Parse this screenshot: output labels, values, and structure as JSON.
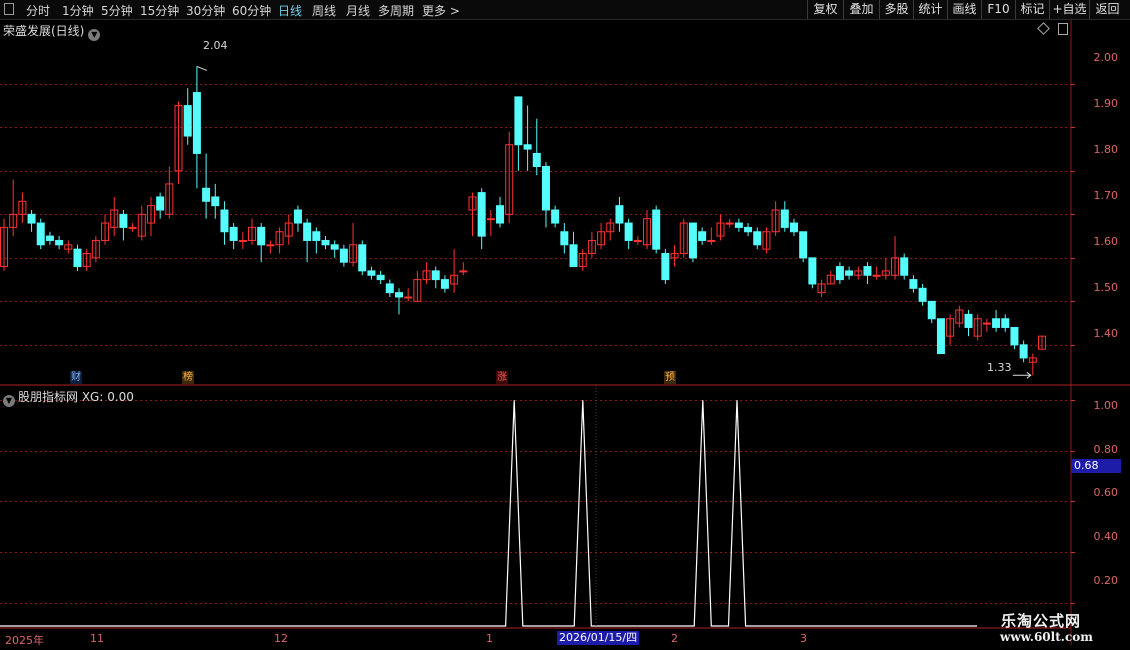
{
  "toolbar": {
    "periods": [
      "分时",
      "1分钟",
      "5分钟",
      "15分钟",
      "30分钟",
      "60分钟",
      "日线",
      "周线",
      "月线",
      "多周期",
      "更多 >"
    ],
    "active_period": "日线",
    "right_buttons": [
      "复权",
      "叠加",
      "多股",
      "统计",
      "画线",
      "F10",
      "标记",
      "+自选",
      "返回"
    ]
  },
  "main_panel": {
    "title": "荣盛发展(日线)",
    "high_label": "2.04",
    "low_label": "1.33",
    "y_ticks": [
      "2.00",
      "1.90",
      "1.80",
      "1.70",
      "1.60",
      "1.50",
      "1.40"
    ],
    "event_markers": [
      "财",
      "榜",
      "涨",
      "预"
    ]
  },
  "indicator_panel": {
    "title": "股朋指标网 XG: 0.00",
    "y_ticks": [
      "1.00",
      "0.80",
      "0.60",
      "0.40",
      "0.20"
    ],
    "current_value": "0.68"
  },
  "date_axis": {
    "labels": [
      "2025年",
      "11",
      "12",
      "1",
      "2",
      "3"
    ],
    "cursor_date": "2026/01/15/四"
  },
  "watermark": {
    "line1": "乐淘公式网",
    "line2": "www.60lt.com"
  },
  "colors": {
    "up": "#ff3232",
    "down": "#54fcfc",
    "background": "#000000",
    "grid": "#8a1a1a",
    "indicator_line": "#ffffff"
  },
  "chart_data": [
    {
      "type": "candlestick",
      "title": "荣盛发展(日线)",
      "ylim": [
        1.31,
        2.11
      ],
      "candles": [
        [
          1.58,
          1.67,
          1.57,
          1.69
        ],
        [
          1.67,
          1.7,
          1.65,
          1.78
        ],
        [
          1.7,
          1.73,
          1.68,
          1.75
        ],
        [
          1.7,
          1.68,
          1.66,
          1.71
        ],
        [
          1.68,
          1.63,
          1.62,
          1.69
        ],
        [
          1.65,
          1.64,
          1.63,
          1.66
        ],
        [
          1.64,
          1.63,
          1.62,
          1.65
        ],
        [
          1.62,
          1.63,
          1.61,
          1.64
        ],
        [
          1.62,
          1.58,
          1.57,
          1.63
        ],
        [
          1.58,
          1.61,
          1.57,
          1.62
        ],
        [
          1.6,
          1.64,
          1.59,
          1.65
        ],
        [
          1.64,
          1.68,
          1.63,
          1.7
        ],
        [
          1.67,
          1.71,
          1.65,
          1.74
        ],
        [
          1.7,
          1.67,
          1.64,
          1.71
        ],
        [
          1.67,
          1.67,
          1.66,
          1.68
        ],
        [
          1.65,
          1.7,
          1.64,
          1.72
        ],
        [
          1.68,
          1.72,
          1.65,
          1.74
        ],
        [
          1.74,
          1.71,
          1.69,
          1.75
        ],
        [
          1.7,
          1.77,
          1.69,
          1.81
        ],
        [
          1.8,
          1.95,
          1.77,
          1.96
        ],
        [
          1.95,
          1.88,
          1.86,
          1.99
        ],
        [
          1.98,
          1.84,
          1.76,
          2.04
        ],
        [
          1.76,
          1.73,
          1.69,
          1.84
        ],
        [
          1.74,
          1.72,
          1.69,
          1.77
        ],
        [
          1.71,
          1.66,
          1.63,
          1.73
        ],
        [
          1.67,
          1.64,
          1.62,
          1.68
        ],
        [
          1.64,
          1.64,
          1.62,
          1.66
        ],
        [
          1.64,
          1.67,
          1.63,
          1.69
        ],
        [
          1.67,
          1.63,
          1.59,
          1.68
        ],
        [
          1.63,
          1.63,
          1.61,
          1.64
        ],
        [
          1.63,
          1.66,
          1.61,
          1.67
        ],
        [
          1.65,
          1.68,
          1.63,
          1.7
        ],
        [
          1.71,
          1.68,
          1.66,
          1.72
        ],
        [
          1.68,
          1.64,
          1.59,
          1.69
        ],
        [
          1.66,
          1.64,
          1.61,
          1.67
        ],
        [
          1.64,
          1.63,
          1.62,
          1.65
        ],
        [
          1.63,
          1.62,
          1.6,
          1.64
        ],
        [
          1.62,
          1.59,
          1.58,
          1.63
        ],
        [
          1.59,
          1.63,
          1.58,
          1.68
        ],
        [
          1.63,
          1.57,
          1.56,
          1.64
        ],
        [
          1.57,
          1.56,
          1.55,
          1.58
        ],
        [
          1.56,
          1.55,
          1.54,
          1.57
        ],
        [
          1.54,
          1.52,
          1.51,
          1.55
        ],
        [
          1.52,
          1.51,
          1.47,
          1.53
        ],
        [
          1.51,
          1.51,
          1.5,
          1.53
        ],
        [
          1.5,
          1.55,
          1.5,
          1.57
        ],
        [
          1.55,
          1.57,
          1.54,
          1.59
        ],
        [
          1.57,
          1.55,
          1.53,
          1.58
        ],
        [
          1.55,
          1.53,
          1.52,
          1.56
        ],
        [
          1.54,
          1.56,
          1.52,
          1.62
        ],
        [
          1.57,
          1.57,
          1.56,
          1.59
        ],
        [
          1.71,
          1.74,
          1.65,
          1.75
        ],
        [
          1.75,
          1.65,
          1.62,
          1.76
        ],
        [
          1.69,
          1.69,
          1.65,
          1.71
        ],
        [
          1.72,
          1.68,
          1.67,
          1.74
        ],
        [
          1.7,
          1.86,
          1.68,
          1.89
        ],
        [
          1.97,
          1.86,
          1.8,
          1.97
        ],
        [
          1.86,
          1.85,
          1.8,
          1.95
        ],
        [
          1.84,
          1.81,
          1.79,
          1.92
        ],
        [
          1.81,
          1.71,
          1.67,
          1.82
        ],
        [
          1.71,
          1.68,
          1.67,
          1.72
        ],
        [
          1.66,
          1.63,
          1.61,
          1.68
        ],
        [
          1.63,
          1.58,
          1.58,
          1.66
        ],
        [
          1.58,
          1.61,
          1.57,
          1.62
        ],
        [
          1.61,
          1.64,
          1.6,
          1.66
        ],
        [
          1.63,
          1.66,
          1.62,
          1.68
        ],
        [
          1.66,
          1.68,
          1.64,
          1.69
        ],
        [
          1.72,
          1.68,
          1.66,
          1.74
        ],
        [
          1.68,
          1.64,
          1.62,
          1.69
        ],
        [
          1.64,
          1.64,
          1.63,
          1.65
        ],
        [
          1.63,
          1.69,
          1.62,
          1.71
        ],
        [
          1.71,
          1.62,
          1.61,
          1.72
        ],
        [
          1.61,
          1.55,
          1.54,
          1.62
        ],
        [
          1.6,
          1.61,
          1.58,
          1.63
        ],
        [
          1.61,
          1.68,
          1.6,
          1.69
        ],
        [
          1.68,
          1.6,
          1.59,
          1.68
        ],
        [
          1.66,
          1.64,
          1.63,
          1.67
        ],
        [
          1.64,
          1.64,
          1.63,
          1.67
        ],
        [
          1.65,
          1.68,
          1.64,
          1.7
        ],
        [
          1.68,
          1.68,
          1.67,
          1.69
        ],
        [
          1.68,
          1.67,
          1.66,
          1.69
        ],
        [
          1.67,
          1.66,
          1.65,
          1.68
        ],
        [
          1.66,
          1.63,
          1.62,
          1.67
        ],
        [
          1.62,
          1.66,
          1.61,
          1.67
        ],
        [
          1.66,
          1.71,
          1.65,
          1.73
        ],
        [
          1.71,
          1.67,
          1.66,
          1.73
        ],
        [
          1.68,
          1.66,
          1.65,
          1.69
        ],
        [
          1.66,
          1.6,
          1.59,
          1.66
        ],
        [
          1.6,
          1.54,
          1.53,
          1.6
        ],
        [
          1.52,
          1.54,
          1.51,
          1.55
        ],
        [
          1.54,
          1.56,
          1.54,
          1.57
        ],
        [
          1.58,
          1.55,
          1.54,
          1.59
        ],
        [
          1.57,
          1.56,
          1.55,
          1.58
        ],
        [
          1.56,
          1.57,
          1.55,
          1.58
        ],
        [
          1.58,
          1.56,
          1.54,
          1.59
        ],
        [
          1.56,
          1.56,
          1.55,
          1.58
        ],
        [
          1.56,
          1.57,
          1.55,
          1.6
        ],
        [
          1.56,
          1.6,
          1.55,
          1.65
        ],
        [
          1.6,
          1.56,
          1.55,
          1.61
        ],
        [
          1.55,
          1.53,
          1.52,
          1.56
        ],
        [
          1.53,
          1.5,
          1.49,
          1.54
        ],
        [
          1.5,
          1.46,
          1.45,
          1.5
        ],
        [
          1.46,
          1.38,
          1.38,
          1.46
        ],
        [
          1.42,
          1.46,
          1.4,
          1.47
        ],
        [
          1.45,
          1.48,
          1.44,
          1.49
        ],
        [
          1.47,
          1.44,
          1.42,
          1.48
        ],
        [
          1.42,
          1.46,
          1.41,
          1.47
        ],
        [
          1.45,
          1.45,
          1.43,
          1.46
        ],
        [
          1.46,
          1.44,
          1.43,
          1.48
        ],
        [
          1.46,
          1.44,
          1.43,
          1.47
        ],
        [
          1.44,
          1.4,
          1.39,
          1.44
        ],
        [
          1.4,
          1.37,
          1.36,
          1.41
        ],
        [
          1.36,
          1.37,
          1.33,
          1.38
        ],
        [
          1.39,
          1.42,
          1.39,
          1.42
        ]
      ]
    },
    {
      "type": "line",
      "title": "股朋指标网 XG: 0.00",
      "ylim": [
        0.1,
        1.06
      ],
      "values": [
        0,
        0,
        0,
        0,
        0,
        0,
        0,
        0,
        0,
        0,
        0,
        0,
        0,
        0,
        0,
        0,
        0,
        0,
        0,
        0,
        0,
        0,
        0,
        0,
        0,
        0,
        0,
        0,
        0,
        0,
        0,
        0,
        0,
        0,
        0,
        0,
        0,
        0,
        0,
        0,
        0,
        0,
        0,
        0,
        0,
        0,
        0,
        0,
        0,
        0,
        0,
        0,
        0,
        0,
        0,
        0,
        0,
        0,
        0,
        0,
        1,
        0,
        0,
        0,
        0,
        0,
        0,
        0,
        1,
        0,
        0,
        0,
        0,
        0,
        0,
        0,
        0,
        0,
        0,
        0,
        0,
        0,
        1,
        0,
        0,
        0,
        1,
        0,
        0,
        0,
        0,
        0,
        0,
        0,
        0,
        0,
        0,
        0,
        0,
        0,
        0,
        0,
        0,
        0,
        0,
        0,
        0,
        0,
        0,
        0,
        0,
        0,
        0,
        0,
        0
      ]
    }
  ]
}
